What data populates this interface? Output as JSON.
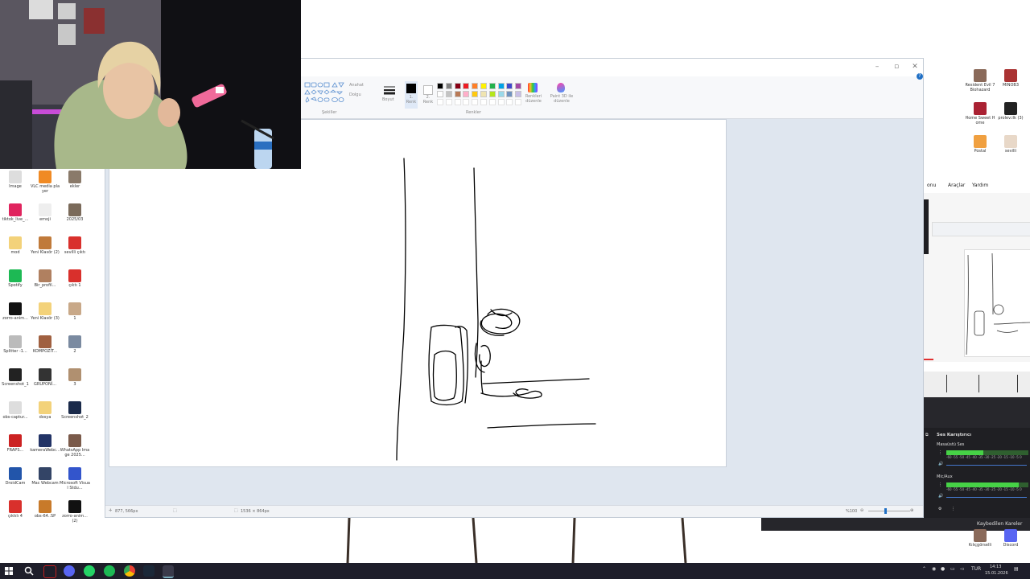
{
  "desktop": {
    "left_icons": [
      {
        "label": "Image",
        "color": "#dddddd"
      },
      {
        "label": "VLC media player",
        "color": "#f08a24"
      },
      {
        "label": "ekler",
        "color": "#8a7a6a"
      },
      {
        "label": "tiktok_live_...",
        "color": "#e0245e"
      },
      {
        "label": "emoji",
        "color": "#eeeeee"
      },
      {
        "label": "2025/03",
        "color": "#7a6a5a"
      },
      {
        "label": "mod",
        "color": "#f3d27a"
      },
      {
        "label": "Yeni Klasör (2)",
        "color": "#c07a3a"
      },
      {
        "label": "sevilli çıktı",
        "color": "#d9302c"
      },
      {
        "label": "Spotify",
        "color": "#1db954"
      },
      {
        "label": "Bir_profil...",
        "color": "#b08060"
      },
      {
        "label": "çıktı 1",
        "color": "#d9302c"
      },
      {
        "label": "zorro-anim...",
        "color": "#111111"
      },
      {
        "label": "Yeni Klasör (3)",
        "color": "#f3d27a"
      },
      {
        "label": "1",
        "color": "#c8a888"
      },
      {
        "label": "Splitter -1...",
        "color": "#bbbbbb"
      },
      {
        "label": "KOMPOZİT...",
        "color": "#a06040"
      },
      {
        "label": "2",
        "color": "#7a8aa0"
      },
      {
        "label": "Screenshot_1",
        "color": "#222222"
      },
      {
        "label": "GRUPONİ...",
        "color": "#333333"
      },
      {
        "label": "3",
        "color": "#b09070"
      },
      {
        "label": "obs-captur...",
        "color": "#dddddd"
      },
      {
        "label": "dosya",
        "color": "#f3d27a"
      },
      {
        "label": "Screenshot_2",
        "color": "#1a2a4a"
      },
      {
        "label": "FRAPS...",
        "color": "#cc2222"
      },
      {
        "label": "kameraWebc...",
        "color": "#223366"
      },
      {
        "label": "WhatsApp Image 2025...",
        "color": "#7a5a4a"
      },
      {
        "label": "DroidCam",
        "color": "#2255aa"
      },
      {
        "label": "Mac Webcam",
        "color": "#334466"
      },
      {
        "label": "Microsoft Visual Stdu...",
        "color": "#3355cc"
      },
      {
        "label": "çıktılı 4",
        "color": "#d9302c"
      },
      {
        "label": "obs-64..SP",
        "color": "#c87a2a"
      },
      {
        "label": "zorro-anim... (2)",
        "color": "#111111"
      }
    ],
    "right_icons": [
      {
        "label": "Resident Evil 7 Biohazard",
        "color": "#8a6a5a"
      },
      {
        "label": "MINOB3",
        "color": "#aa3333"
      },
      {
        "label": "Home Sweet Home",
        "color": "#aa2233"
      },
      {
        "label": "prolev.ilk (3)",
        "color": "#222222"
      },
      {
        "label": "Postal",
        "color": "#f0a040"
      },
      {
        "label": "sevilli",
        "color": "#e8d8c8"
      }
    ],
    "bottom_right_icons": [
      {
        "label": "Kılıçgörselli",
        "color": "#8a6a5a"
      },
      {
        "label": "Discord",
        "color": "#5865f2"
      }
    ]
  },
  "paint": {
    "toolbar": {
      "shapes_label": "Şekiller",
      "outline_label": "Anahat",
      "fill_label": "Dolgu",
      "size_label": "Boyut",
      "color1_label": "1. Renk",
      "color2_label": "2. Renk",
      "colors_label": "Renkler",
      "edit_colors_label": "Renkleri düzenle",
      "paint3d_label": "Paint 3D ile düzenle"
    },
    "palette": [
      "#000000",
      "#7f7f7f",
      "#880015",
      "#ed1c24",
      "#ff7f27",
      "#fff200",
      "#22b14c",
      "#00a2e8",
      "#3f48cc",
      "#a349a4",
      "#ffffff",
      "#c3c3c3",
      "#b97a57",
      "#ffaec9",
      "#ffc90e",
      "#efe4b0",
      "#b5e61d",
      "#99d9ea",
      "#7092be",
      "#c8bfe7"
    ],
    "status": {
      "cursor_pos": "877, 566px",
      "image_size": "1536 × 864px",
      "zoom": "%100"
    }
  },
  "right_panel": {
    "menu": [
      "onu",
      "Araçlar",
      "Yardım"
    ],
    "audio_mixer": {
      "title": "Ses Karıştırıcı",
      "channels": [
        {
          "name": "Masaüstü Ses",
          "level": 0.45
        },
        {
          "name": "Mic/Aux",
          "level": 0.88
        }
      ],
      "scale": "-60 -55 -50 -45 -40 -35 -30 -25 -20 -15 -10 -5 0"
    },
    "dropped_frames": "Kaybedilen Kareler"
  },
  "taskbar": {
    "lang": "TUR",
    "time": "14:13",
    "date": "15.01.2026"
  }
}
